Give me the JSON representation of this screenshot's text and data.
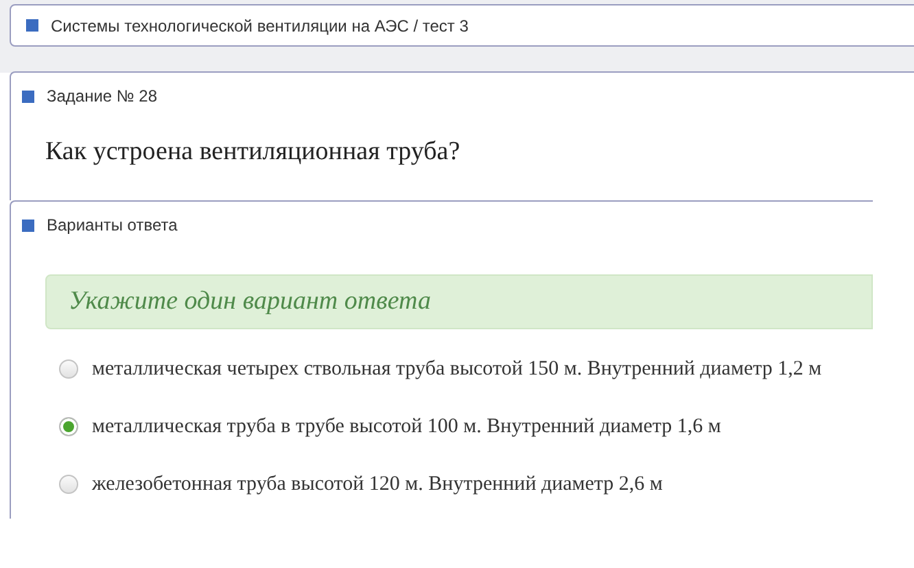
{
  "breadcrumb": "Системы технологической вентиляции на АЭС / тест 3",
  "task": {
    "title": "Задание № 28",
    "question": "Как устроена вентиляционная труба?"
  },
  "answers": {
    "title": "Варианты ответа",
    "hint": "Укажите один вариант ответа",
    "options": [
      {
        "label": "металлическая четырех ствольная труба высотой 150 м. Внутренний диаметр 1,2 м",
        "selected": false
      },
      {
        "label": "металлическая труба в трубе высотой 100 м. Внутренний диаметр 1,6 м",
        "selected": true
      },
      {
        "label": "железобетонная труба высотой 120 м. Внутренний диаметр 2,6 м",
        "selected": false
      }
    ]
  }
}
